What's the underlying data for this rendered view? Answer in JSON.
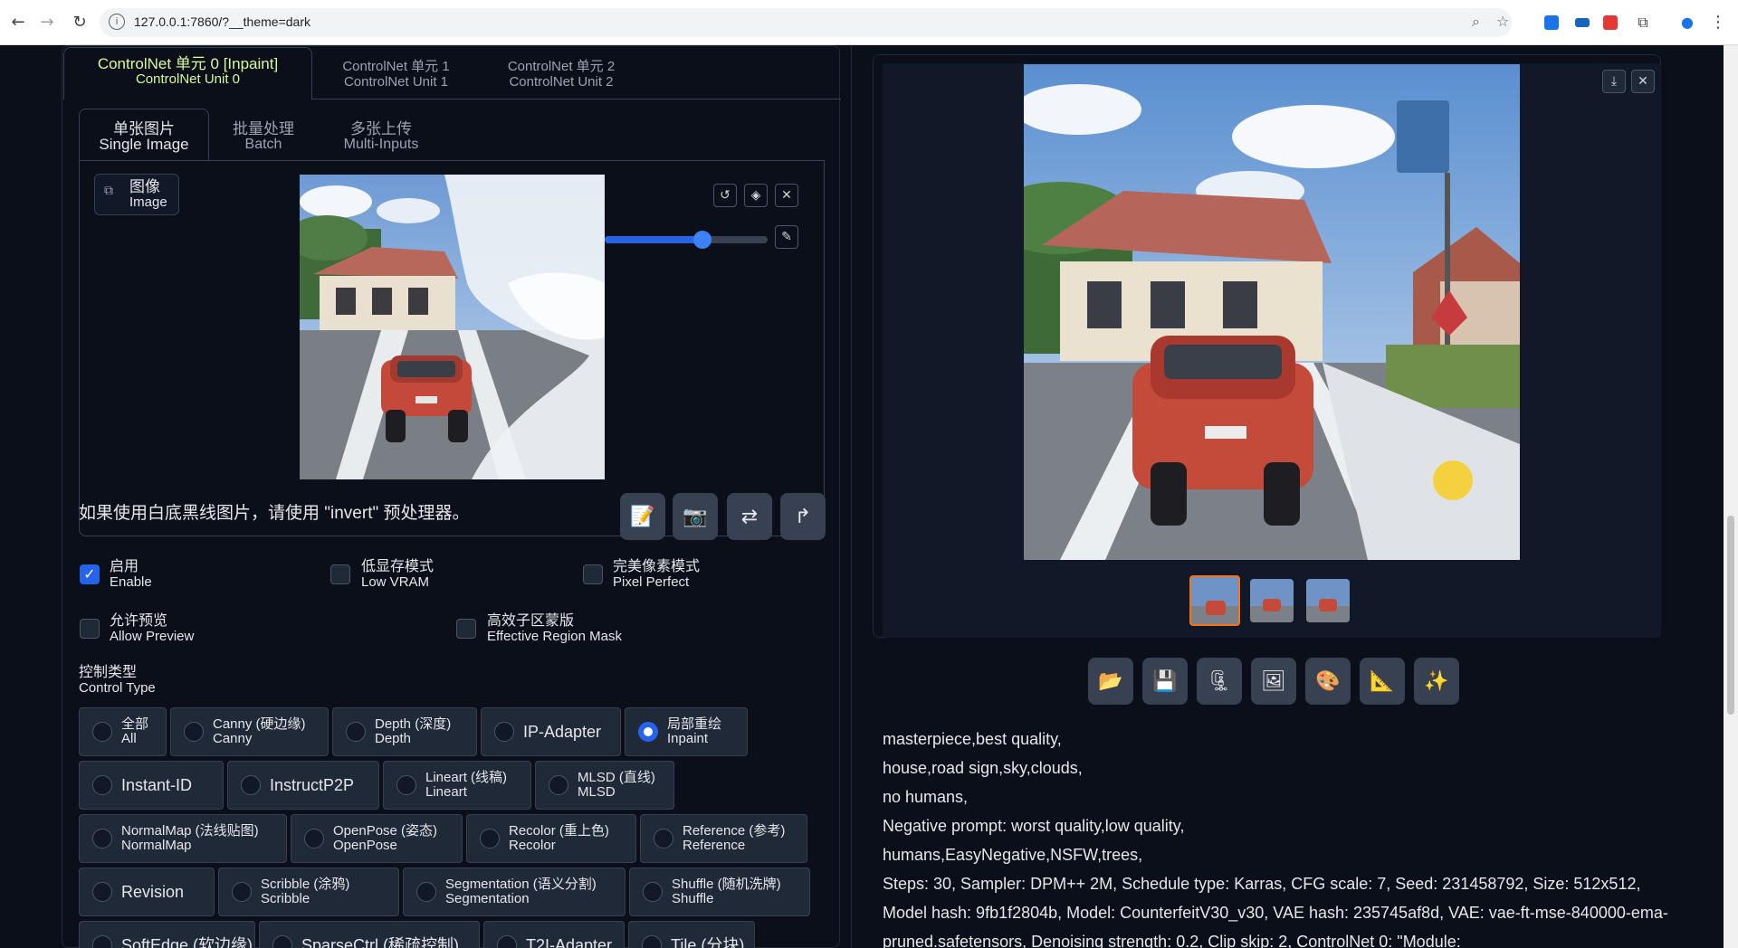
{
  "browser": {
    "url": "127.0.0.1:7860/?__theme=dark"
  },
  "controlnet": {
    "unit_tabs": [
      {
        "line1": "ControlNet 单元 0 [Inpaint]",
        "line2": "ControlNet Unit 0"
      },
      {
        "line1": "ControlNet 单元 1",
        "line2": "ControlNet Unit 1"
      },
      {
        "line1": "ControlNet 单元 2",
        "line2": "ControlNet Unit 2"
      }
    ],
    "mode_tabs": [
      {
        "line1": "单张图片",
        "line2": "Single Image"
      },
      {
        "line1": "批量处理",
        "line2": "Batch"
      },
      {
        "line1": "多张上传",
        "line2": "Multi-Inputs"
      }
    ],
    "image_label": {
      "line1": "图像",
      "line2": "Image"
    },
    "brush_size": 0.6,
    "hint": "如果使用白底黑线图片，请使用 \"invert\" 预处理器。",
    "checkboxes": [
      {
        "line1": "启用",
        "line2": "Enable",
        "checked": true
      },
      {
        "line1": "低显存模式",
        "line2": "Low VRAM",
        "checked": false
      },
      {
        "line1": "完美像素模式",
        "line2": "Pixel Perfect",
        "checked": false
      },
      {
        "line1": "允许预览",
        "line2": "Allow Preview",
        "checked": false
      },
      {
        "line1": "高效子区蒙版",
        "line2": "Effective Region Mask",
        "checked": false
      }
    ],
    "control_type_label": {
      "line1": "控制类型",
      "line2": "Control Type"
    },
    "control_types": {
      "row1": [
        {
          "line1": "全部",
          "line2": "All"
        },
        {
          "line1": "Canny (硬边缘)",
          "line2": "Canny"
        },
        {
          "line1": "Depth (深度)",
          "line2": "Depth"
        },
        {
          "line1": "IP-Adapter",
          "line2": ""
        },
        {
          "line1": "局部重绘",
          "line2": "Inpaint",
          "selected": true
        }
      ],
      "row2": [
        {
          "line1": "Instant-ID",
          "line2": ""
        },
        {
          "line1": "InstructP2P",
          "line2": ""
        },
        {
          "line1": "Lineart (线稿)",
          "line2": "Lineart"
        },
        {
          "line1": "MLSD (直线)",
          "line2": "MLSD"
        }
      ],
      "row3": [
        {
          "line1": "NormalMap (法线贴图)",
          "line2": "NormalMap"
        },
        {
          "line1": "OpenPose (姿态)",
          "line2": "OpenPose"
        },
        {
          "line1": "Recolor (重上色)",
          "line2": "Recolor"
        },
        {
          "line1": "Reference (参考)",
          "line2": "Reference"
        }
      ],
      "row4": [
        {
          "line1": "Revision",
          "line2": ""
        },
        {
          "line1": "Scribble (涂鸦)",
          "line2": "Scribble"
        },
        {
          "line1": "Segmentation (语义分割)",
          "line2": "Segmentation"
        },
        {
          "line1": "Shuffle (随机洗牌)",
          "line2": "Shuffle"
        }
      ],
      "row5": [
        {
          "line1": "SoftEdge (软边缘)",
          "line2": ""
        },
        {
          "line1": "SparseCtrl (稀疏控制)",
          "line2": ""
        },
        {
          "line1": "T2I-Adapter",
          "line2": ""
        },
        {
          "line1": "Tile (分块)",
          "line2": ""
        }
      ]
    }
  },
  "output": {
    "info_lines": [
      "masterpiece,best quality,",
      "house,road sign,sky,clouds,",
      "no humans,",
      "Negative prompt: worst quality,low quality,",
      "humans,EasyNegative,NSFW,trees,",
      "Steps: 30, Sampler: DPM++ 2M, Schedule type: Karras, CFG scale: 7, Seed: 231458792, Size: 512x512,",
      "Model hash: 9fb1f2804b, Model: CounterfeitV30_v30, VAE hash: 235745af8d, VAE: vae-ft-mse-840000-ema-",
      "pruned.safetensors, Denoising strength: 0.2, Clip skip: 2, ControlNet 0: \"Module:"
    ]
  }
}
